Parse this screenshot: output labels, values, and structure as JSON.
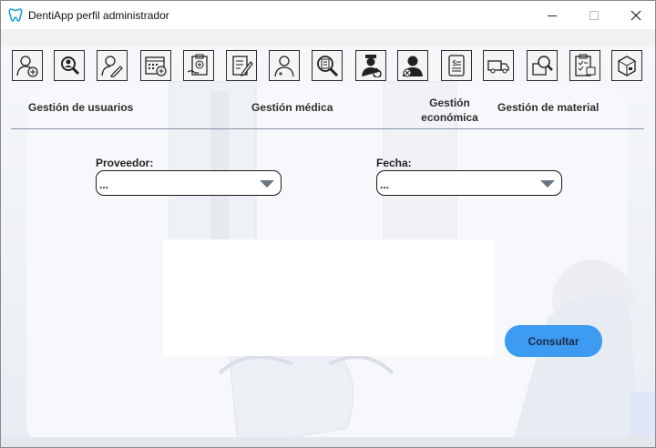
{
  "window": {
    "title": "DentiApp perfil administrador",
    "icon": "tooth-icon",
    "controls": [
      "minimize",
      "maximize",
      "close"
    ]
  },
  "toolbar": {
    "buttons": [
      {
        "icon": "add-user-icon"
      },
      {
        "icon": "search-user-icon"
      },
      {
        "icon": "edit-user-icon"
      },
      {
        "icon": "calendar-add-icon"
      },
      {
        "icon": "medical-clipboard-icon"
      },
      {
        "icon": "edit-document-icon"
      },
      {
        "icon": "doctor-icon"
      },
      {
        "icon": "search-record-icon"
      },
      {
        "icon": "staff-rotate-icon"
      },
      {
        "icon": "doctor-remove-icon"
      },
      {
        "icon": "invoice-icon"
      },
      {
        "icon": "delivery-truck-icon"
      },
      {
        "icon": "search-box-icon"
      },
      {
        "icon": "inventory-clipboard-icon"
      },
      {
        "icon": "package-icon"
      }
    ]
  },
  "sections": {
    "users": "Gestión de usuarios",
    "medical": "Gestión médica",
    "economic_line1": "Gestión",
    "economic_line2": "económica",
    "material": "Gestión de material"
  },
  "form": {
    "proveedor_label": "Proveedor:",
    "proveedor_value": "...",
    "fecha_label": "Fecha:",
    "fecha_value": "...",
    "consult_label": "Consultar"
  },
  "colors": {
    "accent": "#3d9bf2",
    "divider": "#8595a8",
    "tooth_icon": "#1aa6c9"
  }
}
